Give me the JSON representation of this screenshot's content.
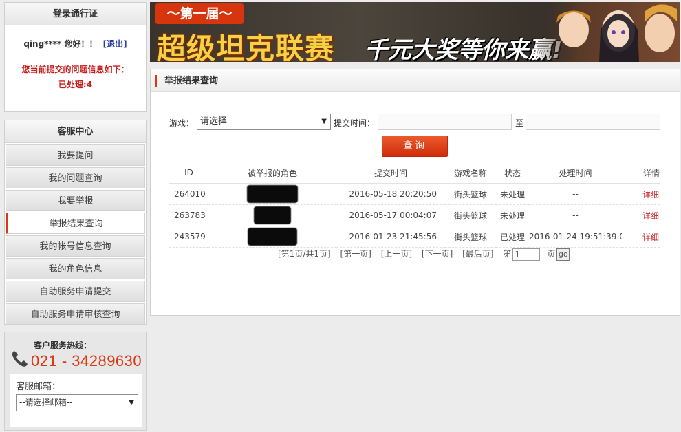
{
  "login": {
    "title": "登录通行证",
    "greeting": "qing**** 您好！！",
    "logout": "[退出]",
    "notice_line1": "您当前提交的问题信息如下：",
    "notice_line2": "已处理:4"
  },
  "service": {
    "title": "客服中心",
    "items": [
      {
        "label": "我要提问"
      },
      {
        "label": "我的问题查询"
      },
      {
        "label": "我要举报"
      },
      {
        "label": "举报结果查询"
      },
      {
        "label": "我的帐号信息查询"
      },
      {
        "label": "我的角色信息"
      },
      {
        "label": "自助服务申请提交"
      },
      {
        "label": "自助服务申请审核查询"
      }
    ],
    "active_index": 3
  },
  "hotline": {
    "label": "客户服务热线：",
    "number": "021 - 34289630",
    "mail_label": "客服邮箱：",
    "mail_select": "--请选择邮箱--",
    "icon": "phone-icon"
  },
  "banner": {
    "subtitle": "～第一届～",
    "title": "超级坦克联赛",
    "slogan": "千元大奖等你来赢!"
  },
  "panel": {
    "title": "举报结果查询",
    "game_label": "游戏：",
    "game_select": "请选择",
    "time_label": "提交时间：",
    "to_label": "至",
    "query_button": "查询"
  },
  "table": {
    "headers": [
      "ID",
      "被举报的角色",
      "提交时间",
      "游戏名称",
      "状态",
      "处理时间",
      "详情"
    ],
    "rows": [
      {
        "id": "264010",
        "submit_time": "2016-05-18 20:20:50",
        "game": "街头篮球",
        "status": "未处理",
        "process_time": "--",
        "detail": "详细"
      },
      {
        "id": "263783",
        "submit_time": "2016-05-17 00:04:07",
        "game": "街头篮球",
        "status": "未处理",
        "process_time": "--",
        "detail": "详细"
      },
      {
        "id": "243579",
        "submit_time": "2016-01-23 21:45:56",
        "game": "街头篮球",
        "status": "已处理",
        "process_time": "2016-01-24 19:51:39.0",
        "detail": "详细"
      }
    ]
  },
  "pager": {
    "info": "[第1页/共1页]",
    "first": "[第一页]",
    "prev": "[上一页]",
    "next": "[下一页]",
    "last": "[最后页]",
    "page_prefix": "第",
    "page_value": "1",
    "page_suffix": "页",
    "go": "go"
  },
  "colors": {
    "accent": "#d63a13",
    "alert": "#c81e1e",
    "hotline": "#d9380f"
  }
}
